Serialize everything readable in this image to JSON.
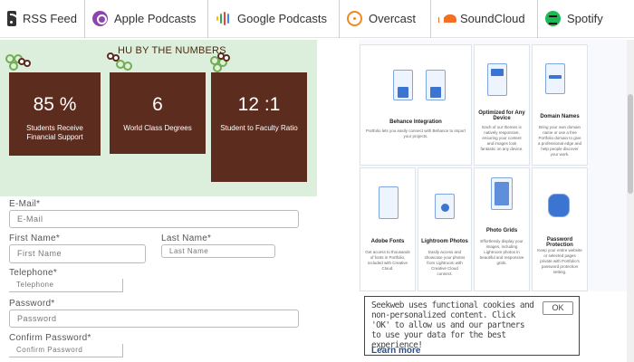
{
  "podcast_bar": {
    "items": [
      {
        "label": "RSS Feed",
        "icon": "rss-icon"
      },
      {
        "label": "Apple Podcasts",
        "icon": "apple-podcasts-icon"
      },
      {
        "label": "Google Podcasts",
        "icon": "google-podcasts-icon"
      },
      {
        "label": "Overcast",
        "icon": "overcast-icon"
      },
      {
        "label": "SoundCloud",
        "icon": "soundcloud-icon"
      },
      {
        "label": "Spotify",
        "icon": "spotify-icon"
      }
    ]
  },
  "numbers": {
    "title": "HU BY THE NUMBERS",
    "cards": [
      {
        "value": "85 %",
        "caption": "Students Receive Financial Support"
      },
      {
        "value": "6",
        "caption": "World Class Degrees"
      },
      {
        "value": "12 :1",
        "caption": "Student to Faculty Ratio"
      }
    ]
  },
  "form": {
    "email": {
      "label": "E-Mail*",
      "placeholder": "E-Mail"
    },
    "first_name": {
      "label": "First Name*",
      "placeholder": "First Name"
    },
    "last_name": {
      "label": "Last Name*",
      "placeholder": "Last Name"
    },
    "telephone": {
      "label": "Telephone*",
      "placeholder": "Telephone"
    },
    "password": {
      "label": "Password*",
      "placeholder": "Password"
    },
    "confirm_password": {
      "label": "Confirm Password*",
      "placeholder": "Confirm Password"
    }
  },
  "features": {
    "items": [
      {
        "title": "Behance Integration",
        "desc": "Portfolio lets you easily connect with Behance to import your projects."
      },
      {
        "title": "Optimized for Any Device",
        "desc": "Each of our themes is natively responsive, ensuring your content and images look fantastic on any device."
      },
      {
        "title": "Domain Names",
        "desc": "Bring your own domain name or use a free Portfolio domain to give a professional edge and help people discover your work."
      },
      {
        "title": "Adobe Fonts",
        "desc": "Get access to thousands of fonts in Portfolio, included with Creative Cloud."
      },
      {
        "title": "Lightroom Photos",
        "desc": "Easily access and showcase your photos from Lightroom with Creative Cloud connect."
      },
      {
        "title": "Photo Grids",
        "desc": "Effortlessly display your images, including Lightroom photos in beautiful and responsive grids."
      },
      {
        "title": "Password Protection",
        "desc": "Keep your entire website or selected pages private with Portfolio's password protection setting."
      }
    ]
  },
  "cookie": {
    "text": "Seekweb uses functional cookies and non-personalized content. Click 'OK' to allow us and our partners to use your data for the best experience!",
    "link": "Learn more",
    "ok": "OK"
  },
  "colors": {
    "card_brown": "#5c2c1e",
    "section_green": "#dbefdc",
    "feature_blue": "#3b74d1"
  }
}
